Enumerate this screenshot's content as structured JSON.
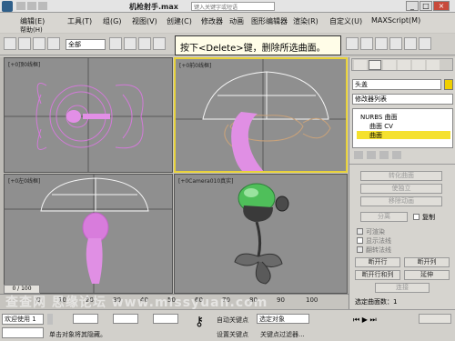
{
  "window": {
    "title": "机枪射手.max",
    "search_placeholder": "键入关键字或短语",
    "controls": [
      "_",
      "□",
      "×"
    ]
  },
  "menu": {
    "row1": [
      "编辑(E)",
      "工具(T)",
      "组(G)",
      "视图(V)",
      "创建(C)",
      "修改器",
      "动画",
      "图形编辑器",
      "渲染(R)",
      "自定义(U)",
      "MAXScript(M)"
    ],
    "row2": [
      "帮助(H)"
    ]
  },
  "toolbar": {
    "filter_select": "全部",
    "tooltip": "按下<Delete>键，删除所选曲面。"
  },
  "viewports": [
    {
      "label": "[+0顶0线框]",
      "active": false
    },
    {
      "label": "[+0前0线框]",
      "active": true
    },
    {
      "label": "[+0左0线框]",
      "active": false
    },
    {
      "label": "[+0Camera010真实]",
      "active": false
    }
  ],
  "panel": {
    "object_name": "头盖",
    "modifier_list": "修改器列表",
    "stack": [
      "NURBS 曲面",
      "曲面 CV",
      "曲面"
    ],
    "buttons_disabled": [
      "转化曲面",
      "使独立",
      "移除动画"
    ],
    "separate": "分离",
    "copy": "复制",
    "checkboxes": [
      "可渲染",
      "显示法线",
      "翻转法线"
    ],
    "buttons": [
      "断开行",
      "断开列",
      "断开行和列",
      "延伸",
      "连接"
    ],
    "selected_count": "选定曲面数：1"
  },
  "timeline": {
    "frame": "0 / 100",
    "ticks": [
      "0",
      "10",
      "20",
      "30",
      "40",
      "50",
      "60",
      "70",
      "80",
      "90",
      "100"
    ]
  },
  "status": {
    "welcome": "欢迎使用 1",
    "prompt": "单击对象将其隐藏。",
    "auto_key": "自动关键点",
    "set_key": "设置关键点",
    "selected_object": "选定对象",
    "key_filter": "关键点过滤器...",
    "add_time_tag": "添加时间标记"
  },
  "watermark": "查查网 思缘论坛 www.missyuan.com"
}
